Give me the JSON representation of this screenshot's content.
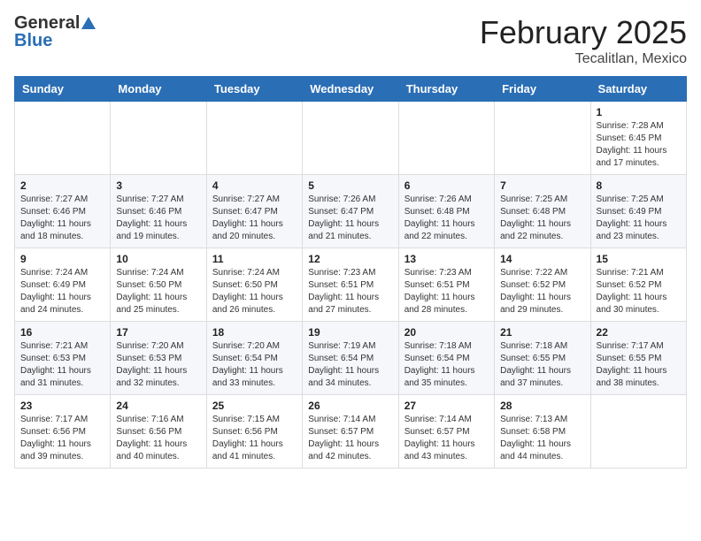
{
  "header": {
    "logo_general": "General",
    "logo_blue": "Blue",
    "month_title": "February 2025",
    "location": "Tecalitlan, Mexico"
  },
  "days_of_week": [
    "Sunday",
    "Monday",
    "Tuesday",
    "Wednesday",
    "Thursday",
    "Friday",
    "Saturday"
  ],
  "weeks": [
    [
      {
        "day": "",
        "info": ""
      },
      {
        "day": "",
        "info": ""
      },
      {
        "day": "",
        "info": ""
      },
      {
        "day": "",
        "info": ""
      },
      {
        "day": "",
        "info": ""
      },
      {
        "day": "",
        "info": ""
      },
      {
        "day": "1",
        "info": "Sunrise: 7:28 AM\nSunset: 6:45 PM\nDaylight: 11 hours\nand 17 minutes."
      }
    ],
    [
      {
        "day": "2",
        "info": "Sunrise: 7:27 AM\nSunset: 6:46 PM\nDaylight: 11 hours\nand 18 minutes."
      },
      {
        "day": "3",
        "info": "Sunrise: 7:27 AM\nSunset: 6:46 PM\nDaylight: 11 hours\nand 19 minutes."
      },
      {
        "day": "4",
        "info": "Sunrise: 7:27 AM\nSunset: 6:47 PM\nDaylight: 11 hours\nand 20 minutes."
      },
      {
        "day": "5",
        "info": "Sunrise: 7:26 AM\nSunset: 6:47 PM\nDaylight: 11 hours\nand 21 minutes."
      },
      {
        "day": "6",
        "info": "Sunrise: 7:26 AM\nSunset: 6:48 PM\nDaylight: 11 hours\nand 22 minutes."
      },
      {
        "day": "7",
        "info": "Sunrise: 7:25 AM\nSunset: 6:48 PM\nDaylight: 11 hours\nand 22 minutes."
      },
      {
        "day": "8",
        "info": "Sunrise: 7:25 AM\nSunset: 6:49 PM\nDaylight: 11 hours\nand 23 minutes."
      }
    ],
    [
      {
        "day": "9",
        "info": "Sunrise: 7:24 AM\nSunset: 6:49 PM\nDaylight: 11 hours\nand 24 minutes."
      },
      {
        "day": "10",
        "info": "Sunrise: 7:24 AM\nSunset: 6:50 PM\nDaylight: 11 hours\nand 25 minutes."
      },
      {
        "day": "11",
        "info": "Sunrise: 7:24 AM\nSunset: 6:50 PM\nDaylight: 11 hours\nand 26 minutes."
      },
      {
        "day": "12",
        "info": "Sunrise: 7:23 AM\nSunset: 6:51 PM\nDaylight: 11 hours\nand 27 minutes."
      },
      {
        "day": "13",
        "info": "Sunrise: 7:23 AM\nSunset: 6:51 PM\nDaylight: 11 hours\nand 28 minutes."
      },
      {
        "day": "14",
        "info": "Sunrise: 7:22 AM\nSunset: 6:52 PM\nDaylight: 11 hours\nand 29 minutes."
      },
      {
        "day": "15",
        "info": "Sunrise: 7:21 AM\nSunset: 6:52 PM\nDaylight: 11 hours\nand 30 minutes."
      }
    ],
    [
      {
        "day": "16",
        "info": "Sunrise: 7:21 AM\nSunset: 6:53 PM\nDaylight: 11 hours\nand 31 minutes."
      },
      {
        "day": "17",
        "info": "Sunrise: 7:20 AM\nSunset: 6:53 PM\nDaylight: 11 hours\nand 32 minutes."
      },
      {
        "day": "18",
        "info": "Sunrise: 7:20 AM\nSunset: 6:54 PM\nDaylight: 11 hours\nand 33 minutes."
      },
      {
        "day": "19",
        "info": "Sunrise: 7:19 AM\nSunset: 6:54 PM\nDaylight: 11 hours\nand 34 minutes."
      },
      {
        "day": "20",
        "info": "Sunrise: 7:18 AM\nSunset: 6:54 PM\nDaylight: 11 hours\nand 35 minutes."
      },
      {
        "day": "21",
        "info": "Sunrise: 7:18 AM\nSunset: 6:55 PM\nDaylight: 11 hours\nand 37 minutes."
      },
      {
        "day": "22",
        "info": "Sunrise: 7:17 AM\nSunset: 6:55 PM\nDaylight: 11 hours\nand 38 minutes."
      }
    ],
    [
      {
        "day": "23",
        "info": "Sunrise: 7:17 AM\nSunset: 6:56 PM\nDaylight: 11 hours\nand 39 minutes."
      },
      {
        "day": "24",
        "info": "Sunrise: 7:16 AM\nSunset: 6:56 PM\nDaylight: 11 hours\nand 40 minutes."
      },
      {
        "day": "25",
        "info": "Sunrise: 7:15 AM\nSunset: 6:56 PM\nDaylight: 11 hours\nand 41 minutes."
      },
      {
        "day": "26",
        "info": "Sunrise: 7:14 AM\nSunset: 6:57 PM\nDaylight: 11 hours\nand 42 minutes."
      },
      {
        "day": "27",
        "info": "Sunrise: 7:14 AM\nSunset: 6:57 PM\nDaylight: 11 hours\nand 43 minutes."
      },
      {
        "day": "28",
        "info": "Sunrise: 7:13 AM\nSunset: 6:58 PM\nDaylight: 11 hours\nand 44 minutes."
      },
      {
        "day": "",
        "info": ""
      }
    ]
  ]
}
